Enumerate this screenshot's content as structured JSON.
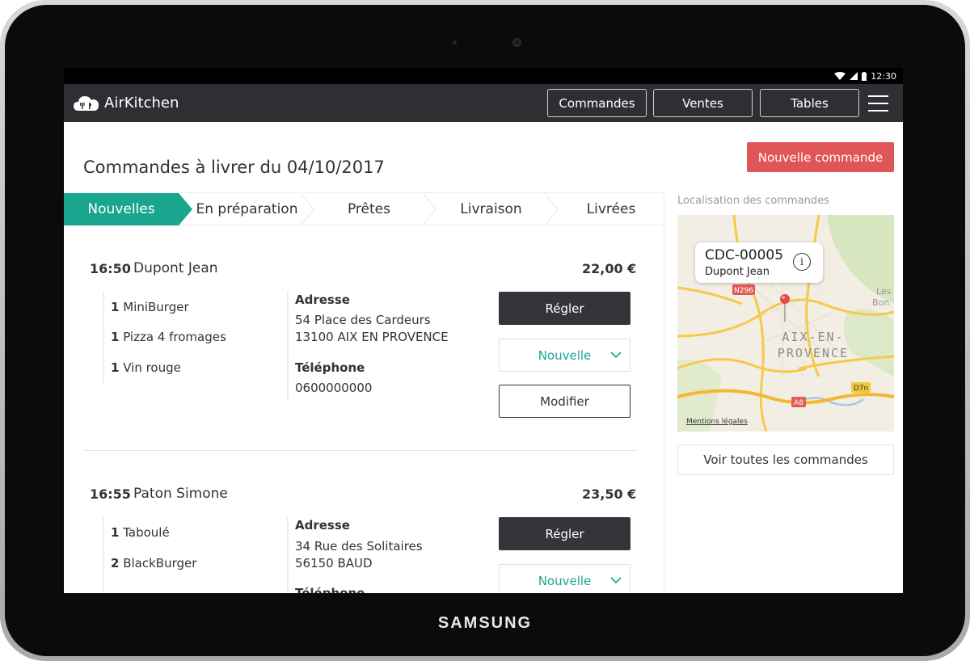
{
  "device": {
    "brand": "SAMSUNG"
  },
  "status_bar": {
    "time": "12:30",
    "icons": [
      "wifi-icon",
      "signal-icon",
      "battery-icon"
    ]
  },
  "app": {
    "name": "AirKitchen"
  },
  "nav": {
    "orders": "Commandes",
    "sales": "Ventes",
    "tables": "Tables"
  },
  "page": {
    "title": "Commandes à livrer du 04/10/2017",
    "new_order": "Nouvelle commande"
  },
  "tabs": [
    "Nouvelles",
    "En préparation",
    "Prêtes",
    "Livraison",
    "Livrées"
  ],
  "labels": {
    "address": "Adresse",
    "phone": "Téléphone",
    "pay": "Régler",
    "edit": "Modifier"
  },
  "orders": [
    {
      "time": "16:50",
      "name": "Dupont Jean",
      "total": "22,00 €",
      "items": [
        {
          "qty": "1",
          "name": "MiniBurger"
        },
        {
          "qty": "1",
          "name": "Pizza 4 fromages"
        },
        {
          "qty": "1",
          "name": "Vin rouge"
        }
      ],
      "address_line1": "54 Place des Cardeurs",
      "address_line2": "13100 AIX EN PROVENCE",
      "phone": "0600000000",
      "status": "Nouvelle"
    },
    {
      "time": "16:55",
      "name": "Paton Simone",
      "total": "23,50 €",
      "items": [
        {
          "qty": "1",
          "name": "Taboulé"
        },
        {
          "qty": "2",
          "name": "BlackBurger"
        }
      ],
      "address_line1": "34 Rue des Solitaires",
      "address_line2": "56150 BAUD",
      "status": "Nouvelle"
    }
  ],
  "map": {
    "title": "Localisation des commandes",
    "callout_id": "CDC-00005",
    "callout_name": "Dupont Jean",
    "city_line1": "AIX-EN-",
    "city_line2": "PROVENCE",
    "place_les": "Les",
    "place_bon": "Bon",
    "road_n296": "N296",
    "road_d7n": "D7n",
    "road_a8": "A8",
    "legal": "Mentions légales",
    "see_all": "Voir toutes les commandes"
  },
  "colors": {
    "accent": "#1aa68e",
    "danger": "#e05555",
    "appbar": "#2e2f33",
    "dark_button": "#34353a"
  }
}
